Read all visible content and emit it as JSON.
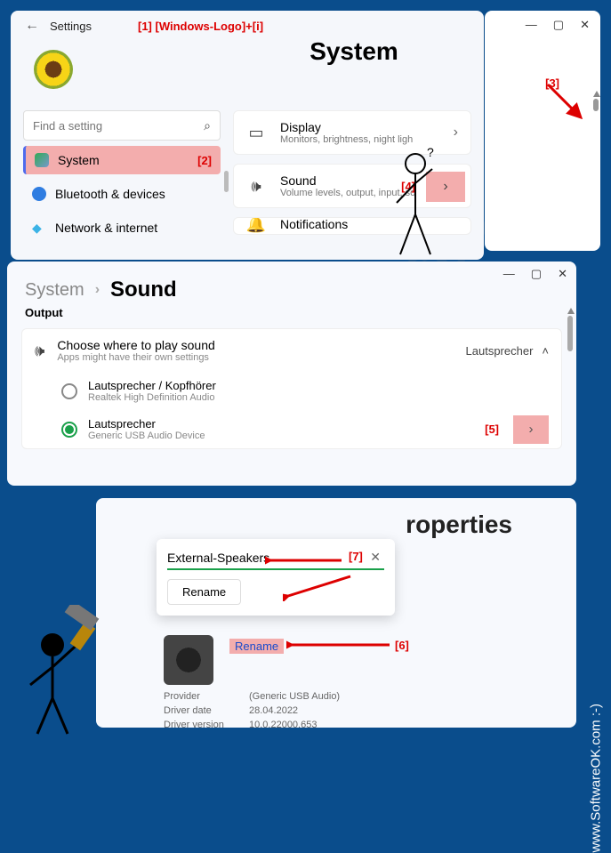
{
  "annotations": {
    "kb_shortcut": "[1]  [Windows-Logo]+[i]",
    "n2": "[2]",
    "n3": "[3]",
    "n4": "[4]",
    "n5": "[5]",
    "n6": "[6]",
    "n7": "[7]"
  },
  "watermark": "SoftwareOK.com",
  "watermark_side": "www.SoftwareOK.com :-)",
  "win1": {
    "back": "←",
    "settings": "Settings",
    "title": "System",
    "search_placeholder": "Find a setting",
    "nav": {
      "system": "System",
      "bluetooth": "Bluetooth & devices",
      "network": "Network & internet"
    },
    "cards": {
      "display": {
        "title": "Display",
        "sub": "Monitors, brightness, night ligh"
      },
      "sound": {
        "title": "Sound",
        "sub": "Volume levels, output, input, so"
      },
      "notif": {
        "title": "Notifications"
      }
    }
  },
  "winmini": {
    "min": "—",
    "max": "▢",
    "close": "✕"
  },
  "win2": {
    "min": "—",
    "max": "▢",
    "close": "✕",
    "crumb_system": "System",
    "crumb_chev": "›",
    "crumb_sound": "Sound",
    "output": "Output",
    "choose": {
      "title": "Choose where to play sound",
      "sub": "Apps might have their own settings",
      "device": "Lautsprecher",
      "caret": "˄"
    },
    "row1": {
      "title": "Lautsprecher / Kopfhörer",
      "sub": "Realtek High Definition Audio"
    },
    "row2": {
      "title": "Lautsprecher",
      "sub": "Generic USB Audio Device"
    }
  },
  "win3": {
    "title": "roperties",
    "input_value": "External-Speakers",
    "clear": "✕",
    "rename_btn": "Rename",
    "rename_link": "Rename",
    "meta": {
      "provider_k": "Provider",
      "provider_v": "(Generic USB Audio)",
      "date_k": "Driver date",
      "date_v": "28.04.2022",
      "ver_k": "Driver version",
      "ver_v": "10.0.22000.653"
    }
  }
}
